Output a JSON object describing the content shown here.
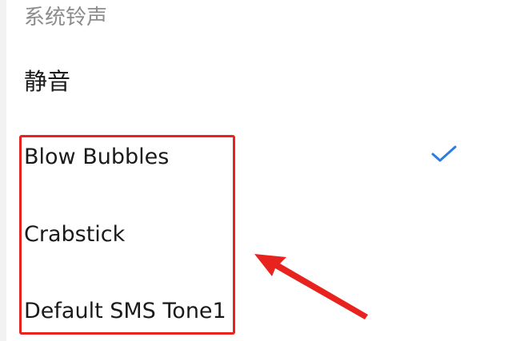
{
  "section": {
    "title": "系统铃声"
  },
  "ringtones": [
    {
      "label": "静音",
      "selected": false
    },
    {
      "label": "Blow Bubbles",
      "selected": true
    },
    {
      "label": "Crabstick",
      "selected": false
    },
    {
      "label": "Default SMS Tone1",
      "selected": false
    }
  ],
  "colors": {
    "check_accent": "#2a7de1",
    "annotation_red": "#e8231d",
    "header_gray": "#8c8c8c",
    "text_dark": "#1a1a1a"
  },
  "icons": {
    "selected_indicator": "checkmark-icon",
    "annotation": "arrow-icon"
  }
}
